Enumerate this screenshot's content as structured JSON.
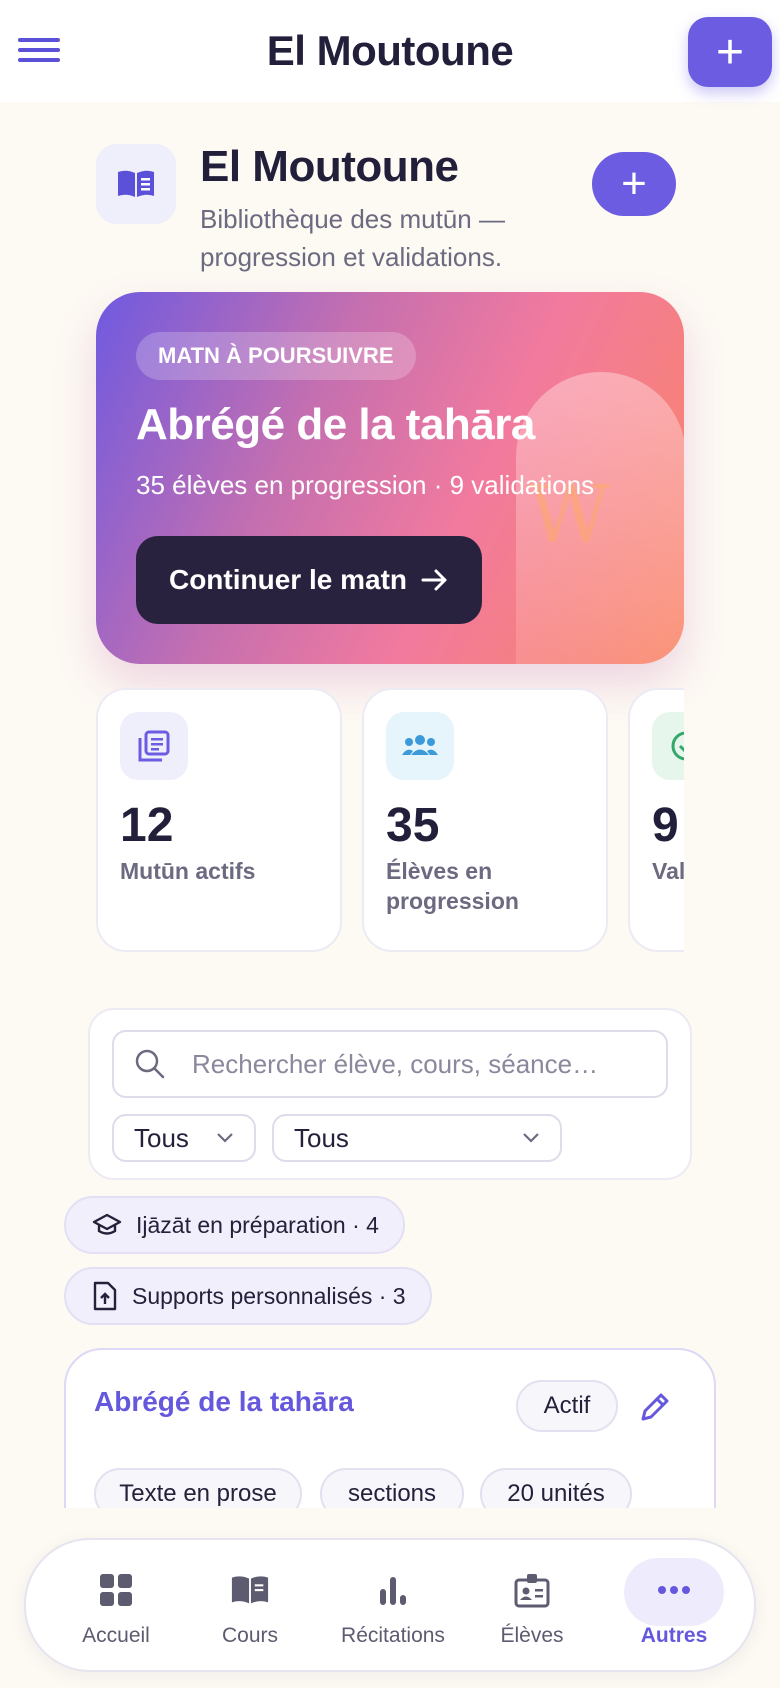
{
  "app": {
    "title": "El Moutoune",
    "menu_icon": "hamburger-menu-icon",
    "add_icon": "plus-icon"
  },
  "header": {
    "title": "El Moutoune",
    "subtitle": "Bibliothèque des mutūn — progression et validations.",
    "icon": "open-book-icon"
  },
  "hero": {
    "tag": "MATN À POURSUIVRE",
    "title": "Abrégé de la tahāra",
    "subtitle": "35 élèves en progression · 9 validations",
    "button": "Continuer le matn",
    "button_icon": "arrow-right-icon"
  },
  "stats": [
    {
      "value": "12",
      "label": "Mutūn actifs",
      "icon": "library-books-icon",
      "color": "#6b5ce1"
    },
    {
      "value": "35",
      "label": "Élèves en progression",
      "icon": "group-icon",
      "color": "#3b9ad9"
    },
    {
      "value": "9",
      "label": "Validations",
      "icon": "check-circle-icon",
      "color": "#36a76b"
    }
  ],
  "filters": {
    "search_placeholder": "Rechercher élève, cours, séance…",
    "select_1": "Tous",
    "select_2": "Tous"
  },
  "chips": [
    {
      "label": "Ijāzāt en préparation · 4",
      "icon": "graduation-cap-icon"
    },
    {
      "label": "Supports personnalisés · 3",
      "icon": "file-upload-icon"
    }
  ],
  "matn_card": {
    "title": "Abrégé de la tahāra",
    "status": "Actif",
    "tags": [
      "Texte en prose",
      "sections",
      "20 unités"
    ]
  },
  "bottom_nav": [
    {
      "label": "Accueil",
      "icon": "grid-icon",
      "active": false
    },
    {
      "label": "Cours",
      "icon": "book-icon",
      "active": false
    },
    {
      "label": "Récitations",
      "icon": "bar-chart-icon",
      "active": false
    },
    {
      "label": "Élèves",
      "icon": "id-badge-icon",
      "active": false
    },
    {
      "label": "Autres",
      "icon": "more-dots-icon",
      "active": true
    }
  ],
  "colors": {
    "accent": "#6b5ce1",
    "dark": "#28223f",
    "background": "#fdf9f3"
  }
}
